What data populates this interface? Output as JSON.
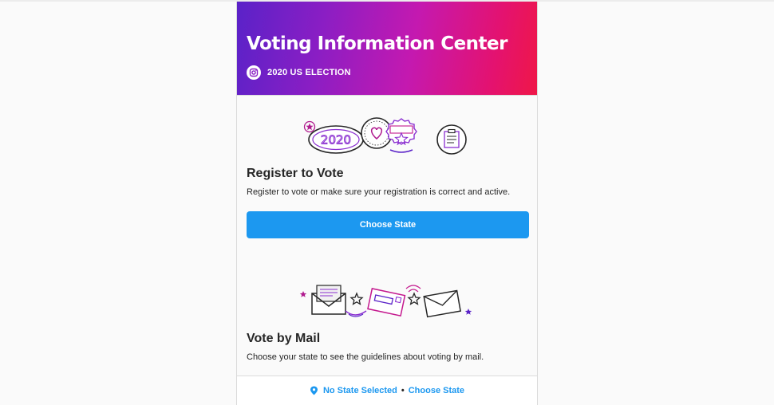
{
  "header": {
    "title": "Voting Information Center",
    "subtitle": "2020 US ELECTION",
    "gradient_start": "#5a22c8",
    "gradient_end": "#ef1748"
  },
  "register": {
    "title": "Register to Vote",
    "description": "Register to vote or make sure your registration is correct and active.",
    "button_label": "Choose State",
    "illustration_text": "2020"
  },
  "mail": {
    "title": "Vote by Mail",
    "description": "Choose your state to see the guidelines about voting by mail."
  },
  "footer": {
    "status": "No State Selected",
    "separator": "•",
    "link": "Choose State"
  },
  "colors": {
    "accent": "#1c98f0",
    "text": "#262626",
    "purple": "#8a2ed0",
    "magenta": "#c4198e"
  },
  "icons": [
    "instagram-icon",
    "location-pin-icon",
    "badges-illustration",
    "mail-illustration"
  ]
}
